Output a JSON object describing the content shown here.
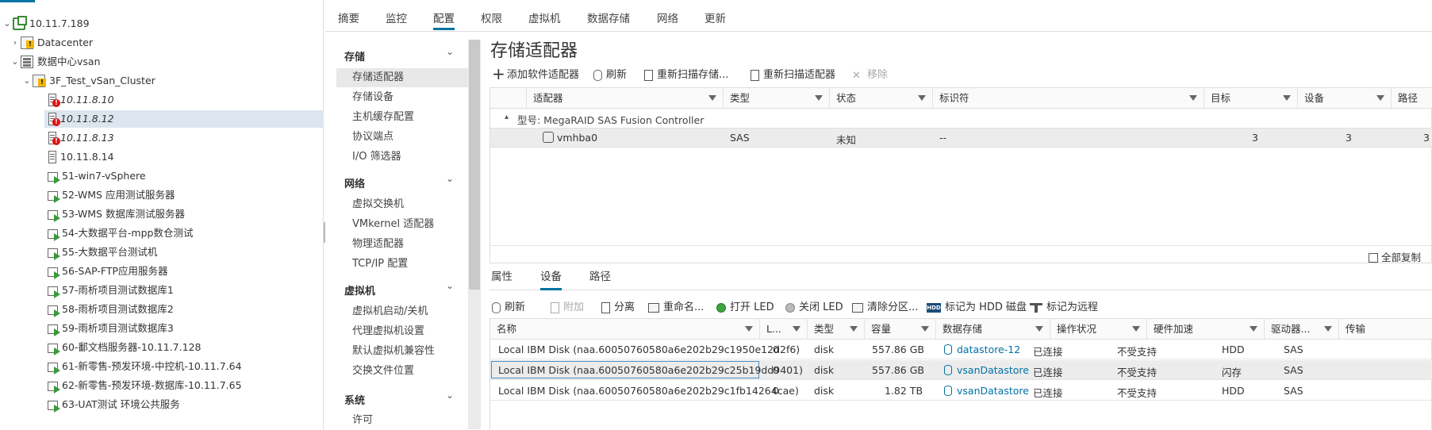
{
  "tree": {
    "items": [
      {
        "label": "10.11.7.189",
        "caret": "⌄",
        "icon": "vcenter-icon"
      },
      {
        "label": "Datacenter",
        "caret": "›",
        "icon": "datacenter-warning-icon"
      },
      {
        "label": "数据中心vsan",
        "caret": "⌄",
        "icon": "datacenter-icon"
      },
      {
        "label": "3F_Test_vSan_Cluster",
        "caret": "⌄",
        "icon": "cluster-warning-icon"
      },
      {
        "label": "10.11.8.10",
        "icon": "host-error-icon"
      },
      {
        "label": "10.11.8.12",
        "icon": "host-error-icon"
      },
      {
        "label": "10.11.8.13",
        "icon": "host-error-icon"
      },
      {
        "label": "10.11.8.14",
        "icon": "host-icon"
      },
      {
        "label": "51-win7-vSphere",
        "icon": "vm-icon"
      },
      {
        "label": "52-WMS 应用测试服务器",
        "icon": "vm-icon"
      },
      {
        "label": "53-WMS 数据库测试服务器",
        "icon": "vm-icon"
      },
      {
        "label": "54-大数据平台-mpp数仓测试",
        "icon": "vm-icon"
      },
      {
        "label": "55-大数据平台测试机",
        "icon": "vm-icon"
      },
      {
        "label": "56-SAP-FTP应用服务器",
        "icon": "vm-icon"
      },
      {
        "label": "57-雨析项目测试数据库1",
        "icon": "vm-icon"
      },
      {
        "label": "58-雨析项目测试数据库2",
        "icon": "vm-icon"
      },
      {
        "label": "59-雨析项目测试数据库3",
        "icon": "vm-icon"
      },
      {
        "label": "60-鄱文档服务器-10.11.7.128",
        "icon": "vm-icon"
      },
      {
        "label": "61-新零售-预发环境-中控机-10.11.7.64",
        "icon": "vm-icon"
      },
      {
        "label": "62-新零售-预发环境-数据库-10.11.7.65",
        "icon": "vm-icon"
      },
      {
        "label": "63-UAT测试 环境公共服务",
        "icon": "vm-icon"
      }
    ]
  },
  "tabs": [
    "摘要",
    "监控",
    "配置",
    "权限",
    "虚拟机",
    "数据存储",
    "网络",
    "更新"
  ],
  "nav": {
    "storage": {
      "title": "存储",
      "items": [
        "存储适配器",
        "存储设备",
        "主机缓存配置",
        "协议端点",
        "I/O 筛选器"
      ]
    },
    "network": {
      "title": "网络",
      "items": [
        "虚拟交换机",
        "VMkernel 适配器",
        "物理适配器",
        "TCP/IP 配置"
      ]
    },
    "vm": {
      "title": "虚拟机",
      "items": [
        "虚拟机启动/关机",
        "代理虚拟机设置",
        "默认虚拟机兼容性",
        "交换文件位置"
      ]
    },
    "system": {
      "title": "系统",
      "items": [
        "许可"
      ]
    }
  },
  "main": {
    "title": "存储适配器",
    "toolbar": [
      "添加软件适配器",
      "刷新",
      "重新扫描存储...",
      "重新扫描适配器",
      "移除"
    ],
    "adapters": {
      "columns": [
        "适配器",
        "类型",
        "状态",
        "标识符",
        "目标",
        "设备",
        "路径"
      ],
      "group": "型号: MegaRAID SAS Fusion Controller",
      "group_caret": "▴",
      "row": {
        "name": "vmhba0",
        "type": "SAS",
        "status": "未知",
        "id": "--",
        "targets": "3",
        "devices": "3",
        "paths": "3"
      },
      "copy_all": "全部复制"
    },
    "subtabs": [
      "属性",
      "设备",
      "路径"
    ],
    "dev_toolbar": [
      "刷新",
      "附加",
      "分离",
      "重命名...",
      "打开 LED",
      "关闭 LED",
      "清除分区...",
      "标记为 HDD 磁盘",
      "标记为远程"
    ],
    "devices": {
      "columns": [
        "名称",
        "L...",
        "类型",
        "容量",
        "数据存储",
        "操作状况",
        "硬件加速",
        "驱动器...",
        "传输"
      ],
      "rows": [
        {
          "name": "Local IBM Disk (naa.60050760580a6e202b29c1950e12d2f6)",
          "lun": "0",
          "type": "disk",
          "capacity": "557.86 GB",
          "datastore": "datastore-12",
          "state": "已连接",
          "hwaccel": "不受支持",
          "drive": "HDD",
          "transport": "SAS"
        },
        {
          "name": "Local IBM Disk (naa.60050760580a6e202b29c25b19dd9401)",
          "lun": "0",
          "type": "disk",
          "capacity": "557.86 GB",
          "datastore": "vsanDatastore",
          "state": "已连接",
          "hwaccel": "不受支持",
          "drive": "闪存",
          "transport": "SAS"
        },
        {
          "name": "Local IBM Disk (naa.60050760580a6e202b29c1fb14264cae)",
          "lun": "0",
          "type": "disk",
          "capacity": "1.82 TB",
          "datastore": "vsanDatastore",
          "state": "已连接",
          "hwaccel": "不受支持",
          "drive": "HDD",
          "transport": "SAS"
        }
      ]
    }
  },
  "colors": {
    "accent": "#0072a3",
    "selection": "#dde6ee"
  }
}
